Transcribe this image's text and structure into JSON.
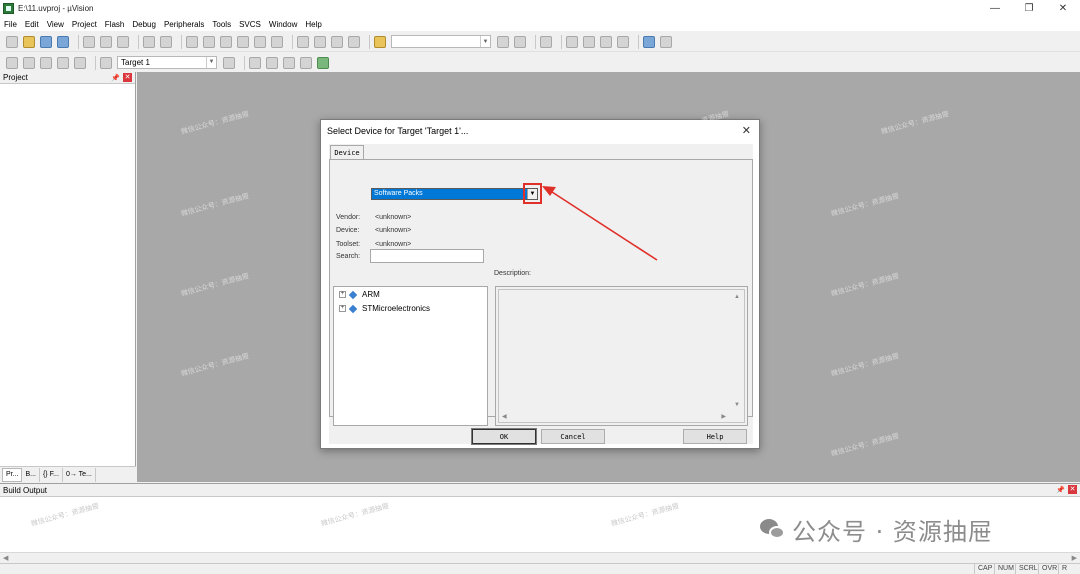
{
  "window": {
    "title": "E:\\11.uvproj - µVision"
  },
  "menu": [
    "File",
    "Edit",
    "View",
    "Project",
    "Flash",
    "Debug",
    "Peripherals",
    "Tools",
    "SVCS",
    "Window",
    "Help"
  ],
  "toolbar2": {
    "target": "Target 1"
  },
  "project_panel": {
    "title": "Project",
    "tabs": [
      "Pr...",
      "B...",
      "{} F...",
      "0→ Te..."
    ]
  },
  "build_output": {
    "title": "Build Output"
  },
  "status_bar": [
    "CAP",
    "NUM",
    "SCRL",
    "OVR",
    "R /W"
  ],
  "dialog": {
    "title": "Select Device for Target 'Target 1'...",
    "tab": "Device",
    "pack_select": "Software Packs",
    "vendor_label": "Vendor:",
    "vendor_value": "<unknown>",
    "device_label": "Device:",
    "device_value": "<unknown>",
    "toolset_label": "Toolset:",
    "toolset_value": "<unknown>",
    "search_label": "Search:",
    "search_value": "",
    "description_label": "Description:",
    "tree": [
      "ARM",
      "STMicroelectronics"
    ],
    "buttons": {
      "ok": "OK",
      "cancel": "Cancel",
      "help": "Help"
    }
  },
  "watermark_text": "微信公众号：资源抽屉",
  "wechat_logo_text": "公众号 · 资源抽屉",
  "colors": {
    "highlight": "#0078d7",
    "annotation": "#e0302a",
    "workspace": "#a8a8a8"
  },
  "icons": {
    "app": "uvision-icon",
    "annotation_arrow": "red-arrow-pointing-to-dropdown"
  }
}
